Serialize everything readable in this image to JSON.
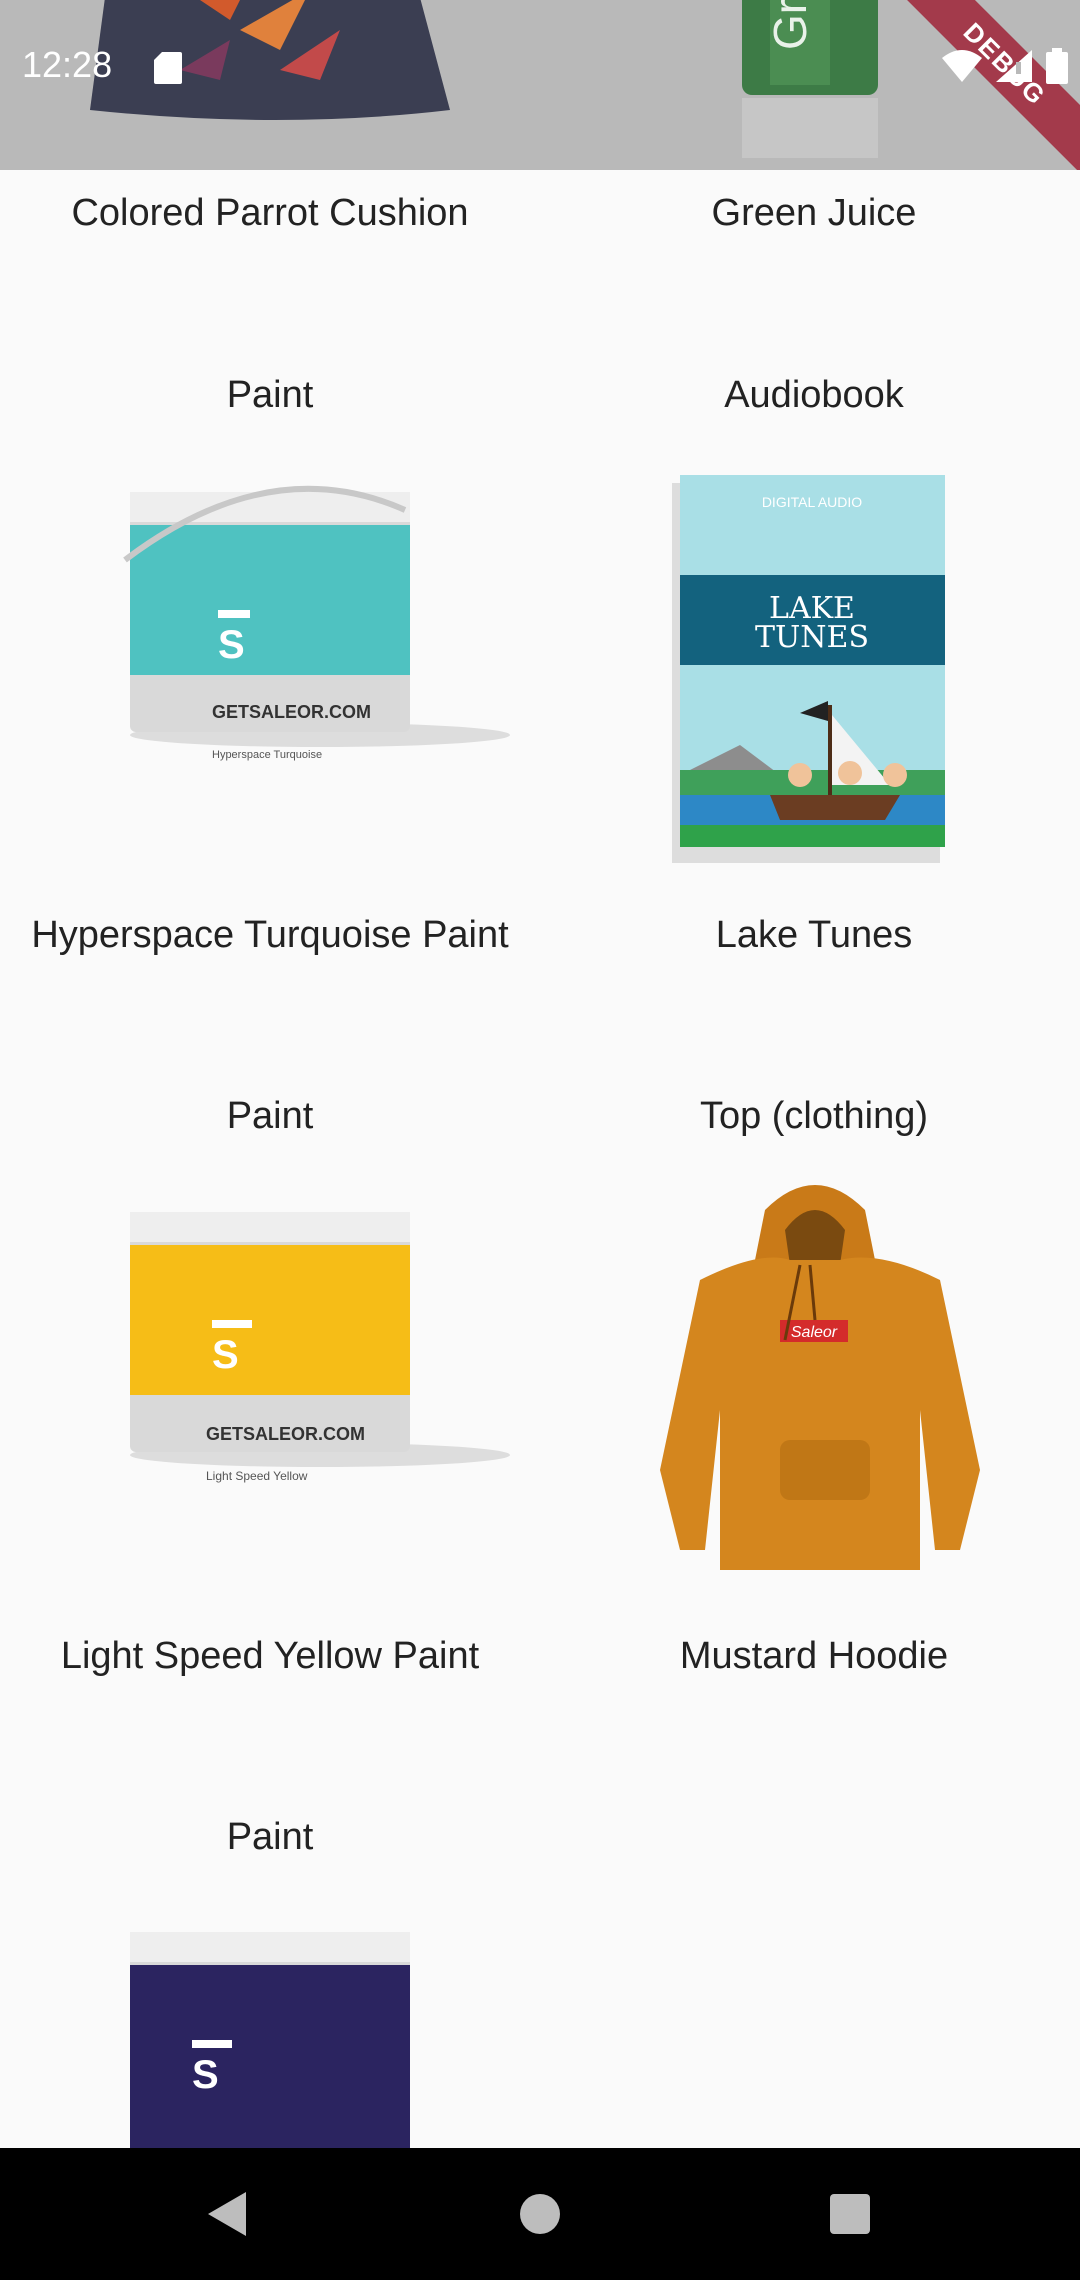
{
  "status_bar": {
    "time": "12:28",
    "debug_banner": "DEBUG"
  },
  "top_row": [
    {
      "name": "Colored Parrot Cushion"
    },
    {
      "name": "Green Juice"
    }
  ],
  "products": [
    {
      "category": "Paint",
      "name": "Hyperspace Turquoise Paint",
      "image": "turquoise-paint-bucket",
      "color": "#4fc2c1",
      "bucket_brand": "GETSALEOR.COM",
      "bucket_text": "Hyperspace Turquoise"
    },
    {
      "category": "Audiobook",
      "name": "Lake Tunes",
      "image": "lake-tunes-book",
      "book_header": "DIGITAL AUDIO",
      "book_title_1": "LAKE",
      "book_title_2": "TUNES"
    },
    {
      "category": "Paint",
      "name": "Light Speed Yellow Paint",
      "image": "yellow-paint-bucket",
      "color": "#f6bd17",
      "bucket_brand": "GETSALEOR.COM",
      "bucket_text": "Light Speed Yellow"
    },
    {
      "category": "Top (clothing)",
      "name": "Mustard Hoodie",
      "image": "mustard-hoodie",
      "color": "#d4861e",
      "hoodie_logo": "Saleor"
    },
    {
      "category": "Paint",
      "name": "",
      "image": "navy-paint-bucket",
      "color": "#2b2460"
    }
  ],
  "nav": {
    "back": "back-icon",
    "home": "home-icon",
    "recents": "recents-icon"
  }
}
